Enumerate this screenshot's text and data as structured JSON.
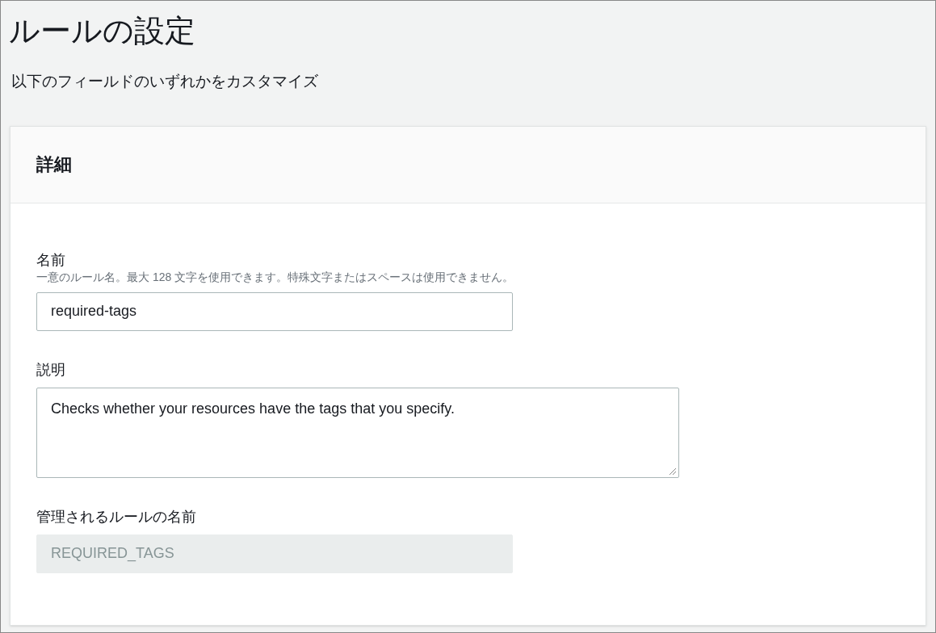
{
  "page": {
    "title": "ルールの設定",
    "subtitle": "以下のフィールドのいずれかをカスタマイズ"
  },
  "section": {
    "title": "詳細",
    "fields": [
      {
        "kind": "input",
        "label": "名前",
        "description": "一意のルール名。最大 128 文字を使用できます。特殊文字またはスペースは使用できません。",
        "value": "required-tags",
        "disabled": false
      },
      {
        "kind": "textarea",
        "label": "説明",
        "value": "Checks whether your resources have the tags that you specify.",
        "disabled": false
      },
      {
        "kind": "input",
        "label": "管理されるルールの名前",
        "value": "REQUIRED_TAGS",
        "disabled": true
      }
    ]
  }
}
